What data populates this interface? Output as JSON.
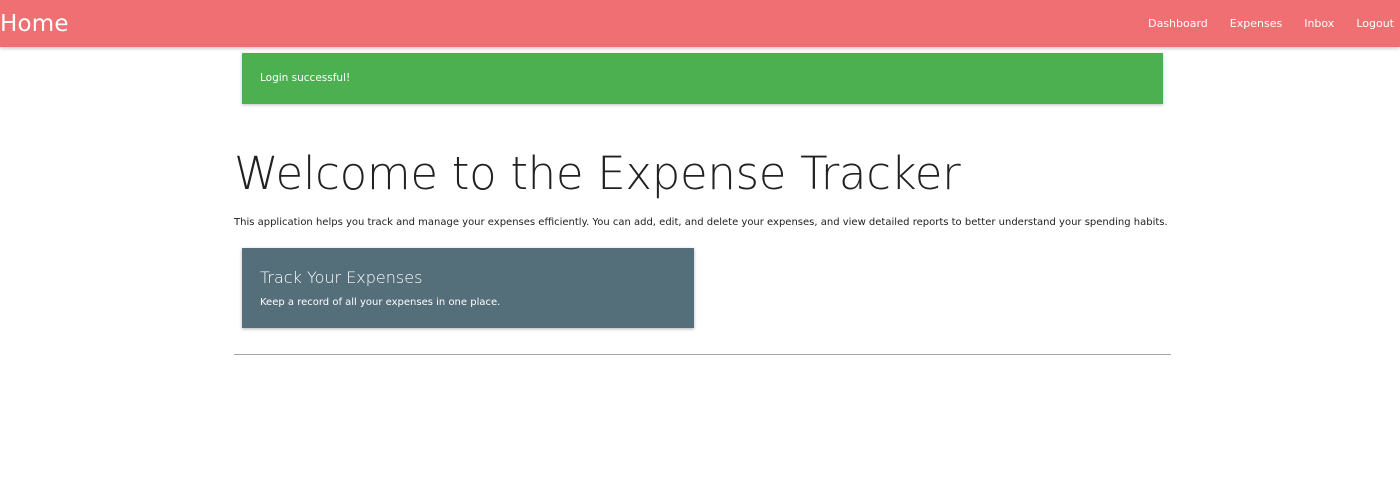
{
  "navbar": {
    "brand": "Home",
    "links": [
      "Dashboard",
      "Expenses",
      "Inbox",
      "Logout"
    ],
    "background_color": "#ef6f73"
  },
  "alert": {
    "message": "Login successful!",
    "color": "#4caf50"
  },
  "main": {
    "title": "Welcome to the Expense Tracker",
    "description": "This application helps you track and manage your expenses efficiently. You can add, edit, and delete your expenses, and view detailed reports to better understand your spending habits."
  },
  "card": {
    "title": "Track Your Expenses",
    "text": "Keep a record of all your expenses in one place.",
    "color": "#546e7a"
  }
}
